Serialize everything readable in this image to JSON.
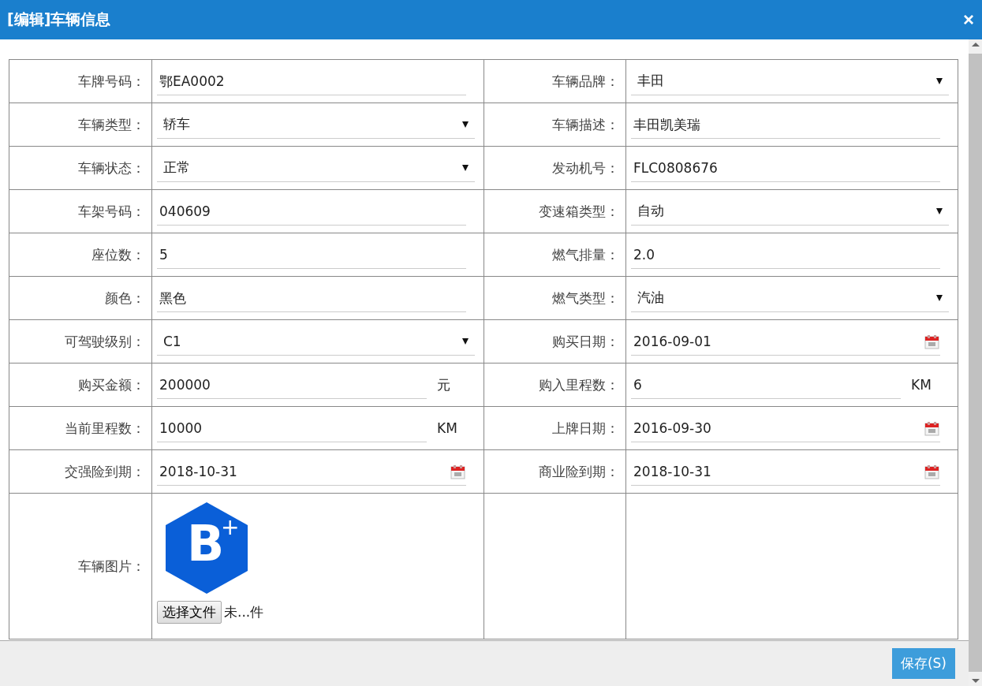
{
  "window": {
    "title": "[编辑]车辆信息",
    "close": "×"
  },
  "rows": [
    [
      {
        "label": "车牌号码：",
        "kind": "text",
        "value": "鄂EA0002"
      },
      {
        "label": "车辆品牌：",
        "kind": "select",
        "value": "丰田"
      }
    ],
    [
      {
        "label": "车辆类型：",
        "kind": "select",
        "value": "轿车"
      },
      {
        "label": "车辆描述：",
        "kind": "text",
        "value": "丰田凯美瑞"
      }
    ],
    [
      {
        "label": "车辆状态：",
        "kind": "select",
        "value": "正常"
      },
      {
        "label": "发动机号：",
        "kind": "text",
        "value": "FLC0808676"
      }
    ],
    [
      {
        "label": "车架号码：",
        "kind": "text",
        "value": "040609"
      },
      {
        "label": "变速箱类型：",
        "kind": "select",
        "value": "自动"
      }
    ],
    [
      {
        "label": "座位数：",
        "kind": "text",
        "value": "5"
      },
      {
        "label": "燃气排量：",
        "kind": "text",
        "value": "2.0"
      }
    ],
    [
      {
        "label": "颜色：",
        "kind": "text",
        "value": "黑色"
      },
      {
        "label": "燃气类型：",
        "kind": "select",
        "value": "汽油"
      }
    ],
    [
      {
        "label": "可驾驶级别：",
        "kind": "select",
        "value": "C1"
      },
      {
        "label": "购买日期：",
        "kind": "date",
        "value": "2016-09-01"
      }
    ],
    [
      {
        "label": "购买金额：",
        "kind": "text",
        "value": "200000",
        "unit": "元"
      },
      {
        "label": "购入里程数：",
        "kind": "text",
        "value": "6",
        "unit": "KM"
      }
    ],
    [
      {
        "label": "当前里程数：",
        "kind": "text",
        "value": "10000",
        "unit": "KM"
      },
      {
        "label": "上牌日期：",
        "kind": "date",
        "value": "2016-09-30"
      }
    ],
    [
      {
        "label": "交强险到期：",
        "kind": "date",
        "value": "2018-10-31"
      },
      {
        "label": "商业险到期：",
        "kind": "date",
        "value": "2018-10-31"
      }
    ]
  ],
  "image_field": {
    "label": "车辆图片：",
    "logo_letter": "B",
    "logo_mark": "+",
    "file_button": "选择文件",
    "file_status": "未...件"
  },
  "footer": {
    "save_button": "保存(S)"
  }
}
